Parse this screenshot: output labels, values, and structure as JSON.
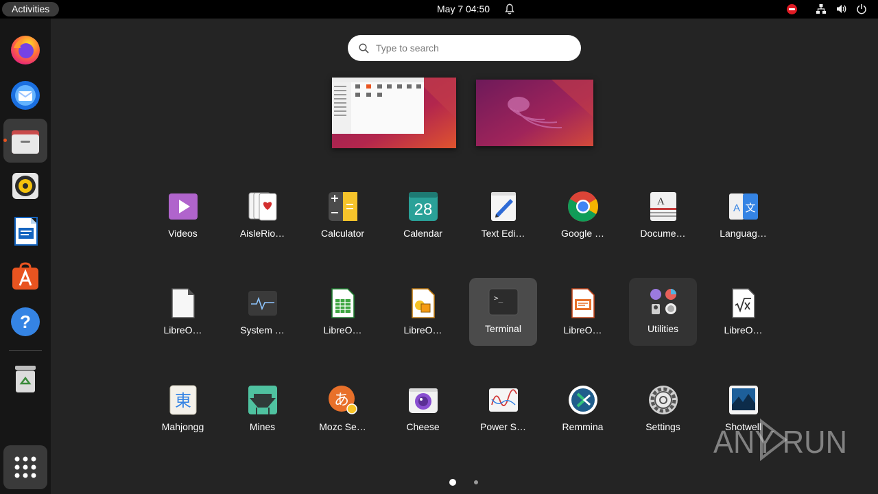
{
  "topbar": {
    "activities": "Activities",
    "clock": "May 7  04:50",
    "tray_icons": [
      "notification-bell-icon",
      "network-icon",
      "volume-icon",
      "power-icon"
    ]
  },
  "dock": {
    "items": [
      {
        "name": "Firefox",
        "icon": "firefox-icon"
      },
      {
        "name": "Thunderbird",
        "icon": "thunderbird-icon"
      },
      {
        "name": "Files",
        "icon": "files-icon",
        "active": true
      },
      {
        "name": "Rhythmbox",
        "icon": "rhythmbox-icon"
      },
      {
        "name": "LibreOffice Writer",
        "icon": "writer-icon"
      },
      {
        "name": "Ubuntu Software",
        "icon": "software-icon"
      },
      {
        "name": "Help",
        "icon": "help-icon"
      },
      {
        "name": "Trash",
        "icon": "trash-icon"
      },
      {
        "name": "Show Applications",
        "icon": "app-grid-icon"
      }
    ]
  },
  "search": {
    "placeholder": "Type to search"
  },
  "apps": [
    {
      "label": "Videos",
      "icon": "videos-icon"
    },
    {
      "label": "AisleRio…",
      "icon": "cards-icon"
    },
    {
      "label": "Calculator",
      "icon": "calculator-icon"
    },
    {
      "label": "Calendar",
      "icon": "calendar-icon",
      "day": "28"
    },
    {
      "label": "Text Edi…",
      "icon": "text-editor-icon"
    },
    {
      "label": "Google …",
      "icon": "chrome-icon"
    },
    {
      "label": "Docume…",
      "icon": "document-viewer-icon"
    },
    {
      "label": "Languag…",
      "icon": "language-icon",
      "glyphs": [
        "A",
        "文"
      ]
    },
    {
      "label": "LibreO…",
      "icon": "libreoffice-icon"
    },
    {
      "label": "System …",
      "icon": "system-monitor-icon"
    },
    {
      "label": "LibreO…",
      "icon": "calc-icon"
    },
    {
      "label": "LibreO…",
      "icon": "draw-icon"
    },
    {
      "label": "Terminal",
      "icon": "terminal-icon",
      "glyph": ">_"
    },
    {
      "label": "LibreO…",
      "icon": "impress-icon"
    },
    {
      "label": "Utilities",
      "icon": "utilities-folder-icon"
    },
    {
      "label": "LibreO…",
      "icon": "math-icon"
    },
    {
      "label": "Mahjongg",
      "icon": "mahjongg-icon",
      "glyph": "東"
    },
    {
      "label": "Mines",
      "icon": "mines-icon"
    },
    {
      "label": "Mozc Se…",
      "icon": "mozc-icon",
      "glyph": "あ"
    },
    {
      "label": "Cheese",
      "icon": "cheese-icon"
    },
    {
      "label": "Power S…",
      "icon": "power-statistics-icon"
    },
    {
      "label": "Remmina",
      "icon": "remmina-icon"
    },
    {
      "label": "Settings",
      "icon": "settings-icon"
    },
    {
      "label": "Shotwell",
      "icon": "shotwell-icon"
    }
  ],
  "pager": {
    "pages": 2,
    "current": 1
  },
  "watermark": {
    "text": "ANY RUN"
  },
  "colors": {
    "accent": "#e95420",
    "panel": "#000000",
    "overview": "#242424",
    "dock": "#161616"
  }
}
